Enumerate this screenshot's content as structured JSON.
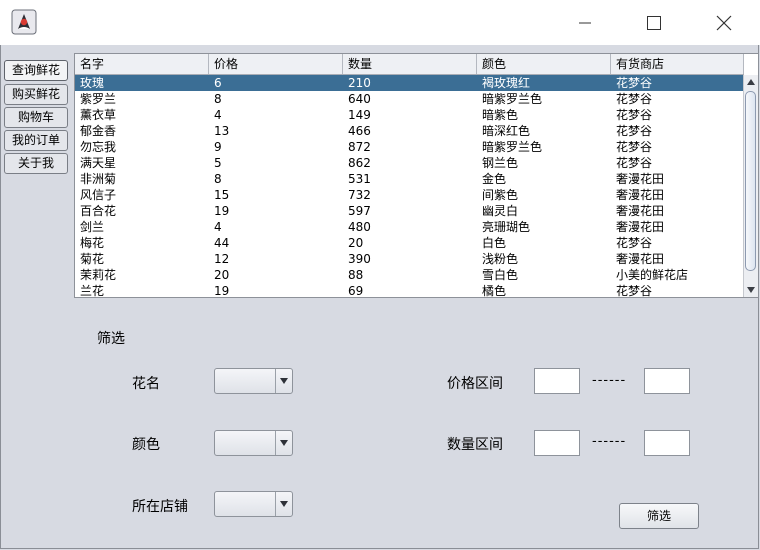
{
  "window": {
    "icons": {
      "app": "java-duke-icon",
      "minimize": "minimize-icon",
      "maximize": "maximize-icon",
      "close": "close-icon"
    }
  },
  "tabs": [
    {
      "label": "查询鲜花",
      "selected": true
    },
    {
      "label": "购买鲜花",
      "selected": false
    },
    {
      "label": "购物车",
      "selected": false
    },
    {
      "label": "我的订单",
      "selected": false
    },
    {
      "label": "关于我",
      "selected": false
    }
  ],
  "table": {
    "columns": [
      "名字",
      "价格",
      "数量",
      "颜色",
      "有货商店"
    ],
    "selected_row": 0,
    "rows": [
      [
        "玫瑰",
        "6",
        "210",
        "褐玫瑰红",
        "花梦谷"
      ],
      [
        "紫罗兰",
        "8",
        "640",
        "暗紫罗兰色",
        "花梦谷"
      ],
      [
        "薰衣草",
        "4",
        "149",
        "暗紫色",
        "花梦谷"
      ],
      [
        "郁金香",
        "13",
        "466",
        "暗深红色",
        "花梦谷"
      ],
      [
        "勿忘我",
        "9",
        "872",
        "暗紫罗兰色",
        "花梦谷"
      ],
      [
        "满天星",
        "5",
        "862",
        "钢兰色",
        "花梦谷"
      ],
      [
        "非洲菊",
        "8",
        "531",
        "金色",
        "奢漫花田"
      ],
      [
        "风信子",
        "15",
        "732",
        "间紫色",
        "奢漫花田"
      ],
      [
        "百合花",
        "19",
        "597",
        "幽灵白",
        "奢漫花田"
      ],
      [
        "剑兰",
        "4",
        "480",
        "亮珊瑚色",
        "奢漫花田"
      ],
      [
        "梅花",
        "44",
        "20",
        "白色",
        "花梦谷"
      ],
      [
        "菊花",
        "12",
        "390",
        "浅粉色",
        "奢漫花田"
      ],
      [
        "茉莉花",
        "20",
        "88",
        "雪白色",
        "小美的鲜花店"
      ],
      [
        "兰花",
        "19",
        "69",
        "橘色",
        "花梦谷"
      ]
    ]
  },
  "filter": {
    "title": "筛选",
    "flower_name_label": "花名",
    "color_label": "颜色",
    "store_label": "所在店铺",
    "price_range_label": "价格区间",
    "quantity_range_label": "数量区间",
    "range_separator": "------",
    "submit_label": "筛选"
  },
  "colors": {
    "selection": "#3b6e95",
    "background": "#d7dae2"
  }
}
